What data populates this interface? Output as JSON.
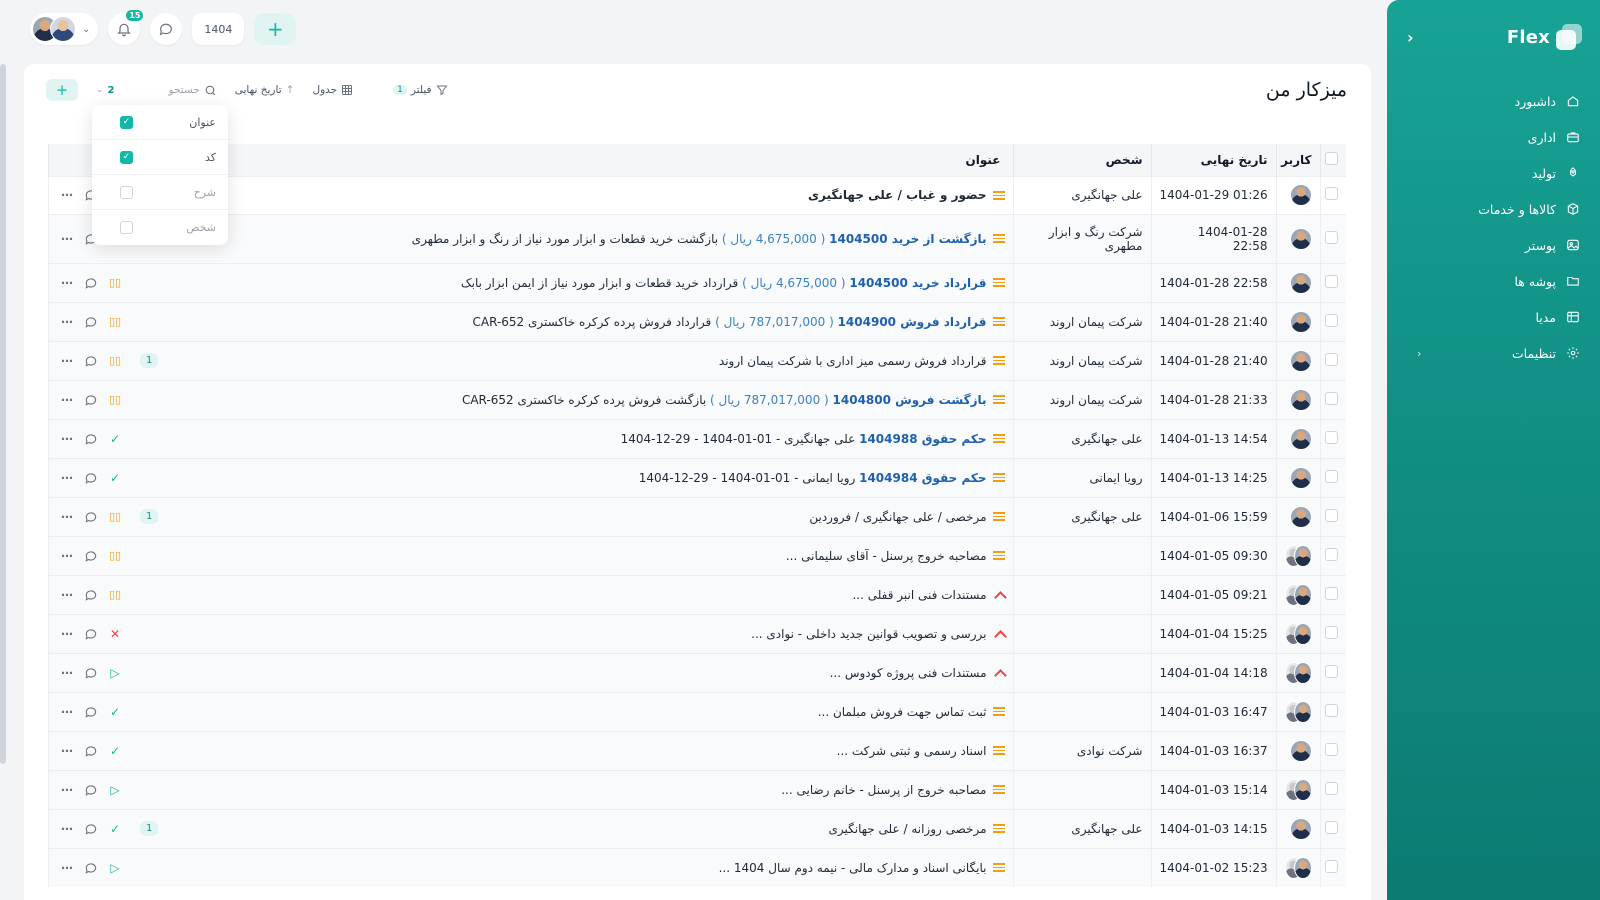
{
  "app": {
    "brand": "Flex"
  },
  "sidebar": {
    "items": [
      {
        "label": "داشبورد",
        "icon": "home-icon"
      },
      {
        "label": "اداری",
        "icon": "briefcase-icon"
      },
      {
        "label": "تولید",
        "icon": "rocket-icon"
      },
      {
        "label": "کالاها و خدمات",
        "icon": "box-icon"
      },
      {
        "label": "پوستر",
        "icon": "image-icon"
      },
      {
        "label": "پوشه ها",
        "icon": "folder-icon"
      },
      {
        "label": "مدیا",
        "icon": "media-icon"
      },
      {
        "label": "تنظیمات",
        "icon": "gear-icon"
      }
    ]
  },
  "topbar": {
    "notifications": "15",
    "year": "1404"
  },
  "page": {
    "title": "میزکار من"
  },
  "toolbar": {
    "filter_label": "فیلتر",
    "filter_count": "1",
    "view_label": "جدول",
    "sort_label": "تاریخ نهایی",
    "search_placeholder": "جستجو",
    "columns_count": "2"
  },
  "column_menu": [
    {
      "label": "عنوان",
      "checked": true
    },
    {
      "label": "کد",
      "checked": true
    },
    {
      "label": "شرح",
      "checked": false
    },
    {
      "label": "شخص",
      "checked": false
    }
  ],
  "table": {
    "headers": {
      "user": "کاربر",
      "date": "تاریخ نهایی",
      "person": "شخص",
      "title": "عنوان"
    },
    "rows": [
      {
        "date": "1404-01-29 01:26",
        "person": "علی جهانگیری",
        "link": "",
        "amount": "",
        "title": "حضور و غیاب / علی جهانگیری",
        "priority": "medium",
        "status": "",
        "sub": "",
        "bold": true
      },
      {
        "date": "1404-01-28 22:58",
        "person": "شرکت رنگ و ابزار مطهری",
        "link": "بازگشت از خرید 1404500",
        "amount": "( 4,675,000 ریال )",
        "title": "بازگشت خرید قطعات و ابزار مورد نیاز از رنگ و ابزار مطهری",
        "priority": "medium",
        "status": "",
        "sub": ""
      },
      {
        "date": "1404-01-28 22:58",
        "person": "",
        "link": "قرارداد خرید 1404500",
        "amount": "( 4,675,000 ریال )",
        "title": "قرارداد خرید قطعات و ابزار مورد نیاز از ایمن ابزار بابک",
        "priority": "medium",
        "status": "pause",
        "sub": ""
      },
      {
        "date": "1404-01-28 21:40",
        "person": "شرکت پیمان اروند",
        "link": "قرارداد فروش 1404900",
        "amount": "( 787,017,000 ریال )",
        "title": "قرارداد فروش پرده کرکره خاکستری CAR-652",
        "priority": "medium",
        "status": "pause",
        "sub": ""
      },
      {
        "date": "1404-01-28 21:40",
        "person": "شرکت پیمان اروند",
        "link": "",
        "amount": "",
        "title": "قرارداد فروش رسمی میز اداری با شرکت پیمان اروند",
        "priority": "medium",
        "status": "pause",
        "sub": "1"
      },
      {
        "date": "1404-01-28 21:33",
        "person": "شرکت پیمان اروند",
        "link": "بازگشت فروش 1404800",
        "amount": "( 787,017,000 ریال )",
        "title": "بازگشت فروش پرده کرکره خاکستری CAR-652",
        "priority": "medium",
        "status": "pause",
        "sub": ""
      },
      {
        "date": "1404-01-13 14:54",
        "person": "علی جهانگیری",
        "link": "حکم حقوق 1404988",
        "amount": "",
        "title": "علی جهانگیری - 01-01-1404 - 29-12-1404",
        "priority": "medium",
        "status": "ok",
        "sub": ""
      },
      {
        "date": "1404-01-13 14:25",
        "person": "رویا ایمانی",
        "link": "حکم حقوق 1404984",
        "amount": "",
        "title": "رویا ایمانی - 01-01-1404 - 29-12-1404",
        "priority": "medium",
        "status": "ok",
        "sub": ""
      },
      {
        "date": "1404-01-06 15:59",
        "person": "علی جهانگیری",
        "link": "",
        "amount": "",
        "title": "مرخصی / علی جهانگیری / فروردین",
        "priority": "medium",
        "status": "pause",
        "sub": "1"
      },
      {
        "date": "1404-01-05 09:30",
        "person": "",
        "link": "",
        "amount": "",
        "title": "مصاحبه خروج پرسنل - آقای سلیمانی ...",
        "priority": "medium",
        "status": "pause",
        "sub": ""
      },
      {
        "date": "1404-01-05 09:21",
        "person": "",
        "link": "",
        "amount": "",
        "title": "مستندات فنی انبر قفلی ...",
        "priority": "high",
        "status": "pause",
        "sub": ""
      },
      {
        "date": "1404-01-04 15:25",
        "person": "",
        "link": "",
        "amount": "",
        "title": "بررسی و تصویب قوانین جدید داخلی - نوادی ...",
        "priority": "high",
        "status": "no",
        "sub": ""
      },
      {
        "date": "1404-01-04 14:18",
        "person": "",
        "link": "",
        "amount": "",
        "title": "مستندات فنی پروژه کودوس ...",
        "priority": "high",
        "status": "play",
        "sub": ""
      },
      {
        "date": "1404-01-03 16:47",
        "person": "",
        "link": "",
        "amount": "",
        "title": "ثبت تماس جهت فروش مبلمان ...",
        "priority": "medium",
        "status": "ok",
        "sub": ""
      },
      {
        "date": "1404-01-03 16:37",
        "person": "شرکت نوادی",
        "link": "",
        "amount": "",
        "title": "اسناد رسمی و ثبتی شرکت ...",
        "priority": "medium",
        "status": "ok",
        "sub": ""
      },
      {
        "date": "1404-01-03 15:14",
        "person": "",
        "link": "",
        "amount": "",
        "title": "مصاحبه خروج از پرسنل - خانم رضایی ...",
        "priority": "medium",
        "status": "play",
        "sub": ""
      },
      {
        "date": "1404-01-03 14:15",
        "person": "علی جهانگیری",
        "link": "",
        "amount": "",
        "title": "مرخصی روزانه / علی جهانگیری",
        "priority": "medium",
        "status": "ok",
        "sub": "1"
      },
      {
        "date": "1404-01-02 15:23",
        "person": "",
        "link": "",
        "amount": "",
        "title": "بایگانی اسناد و مدارک مالی - نیمه دوم سال 1404 ...",
        "priority": "medium",
        "status": "play",
        "sub": ""
      }
    ]
  }
}
